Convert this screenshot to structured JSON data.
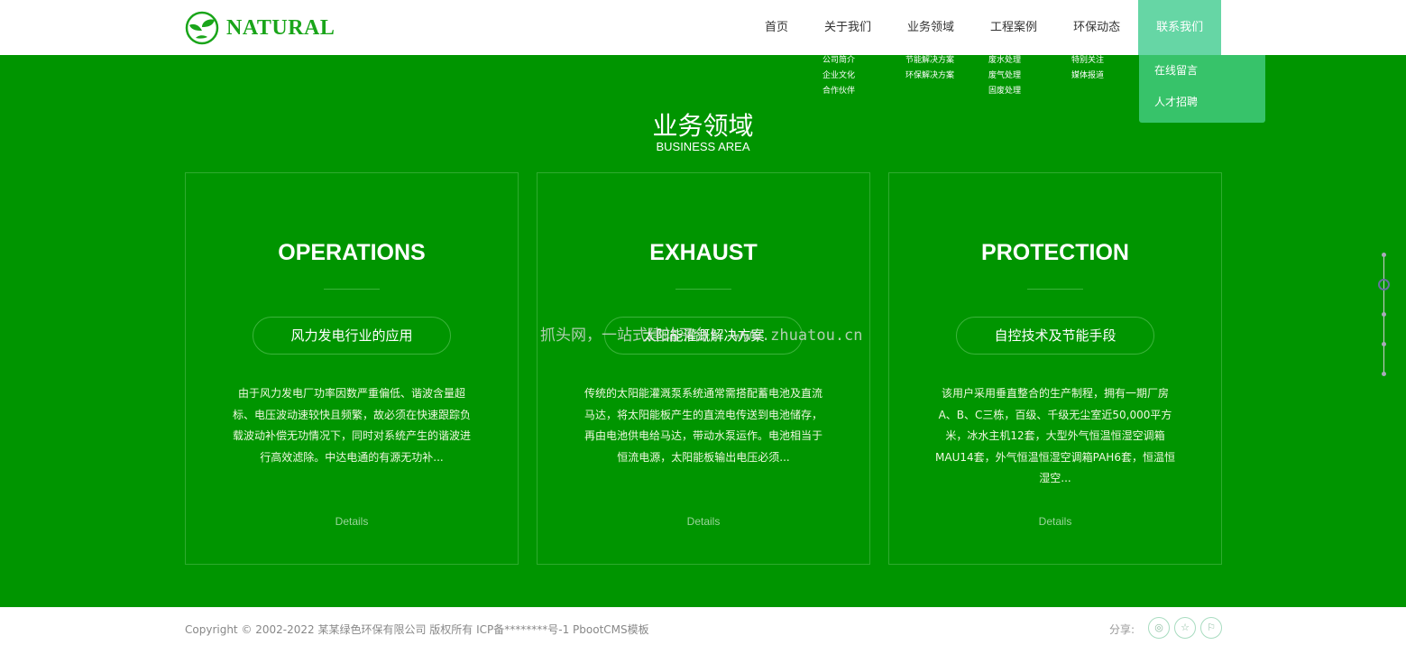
{
  "logo": {
    "text": "NATURAL"
  },
  "nav": {
    "items": [
      "首页",
      "关于我们",
      "业务领域",
      "工程案例",
      "环保动态",
      "联系我们"
    ]
  },
  "submenus": {
    "about": [
      "公司简介",
      "企业文化",
      "合作伙伴"
    ],
    "business": [
      "节能解决方案",
      "环保解决方案"
    ],
    "cases": [
      "废水处理",
      "废气处理",
      "固废处理"
    ],
    "news": [
      "特别关注",
      "媒体报道"
    ],
    "contact": [
      "在线留言",
      "人才招聘"
    ]
  },
  "section": {
    "title": "业务领域",
    "subtitle": "BUSINESS AREA"
  },
  "cards": [
    {
      "title": "OPERATIONS",
      "pill": "风力发电行业的应用",
      "text": "由于风力发电厂功率因数严重偏低、谐波含量超标、电压波动速较快且频繁，故必须在快速跟踪负载波动补偿无功情况下，同时对系统产生的谐波进行高效滤除。中达电通的有源无功补...",
      "details": "Details"
    },
    {
      "title": "EXHAUST",
      "pill": "太阳能灌溉解决方案",
      "text": "传统的太阳能灌溉泵系统通常需搭配蓄电池及直流马达，将太阳能板产生的直流电传送到电池储存，再由电池供电给马达，带动水泵运作。电池相当于恒流电源，太阳能板输出电压必须...",
      "details": "Details"
    },
    {
      "title": "PROTECTION",
      "pill": "自控技术及节能手段",
      "text": "该用户采用垂直整合的生产制程，拥有一期厂房A、B、C三栋，百级、千级无尘室近50,000平方米，冰水主机12套，大型外气恒温恒湿空调箱MAU14套，外气恒温恒湿空调箱PAH6套，恒温恒湿空...",
      "details": "Details"
    }
  ],
  "watermark": "抓头网，一站式建站平台！ www.zhuatou.cn",
  "footer": {
    "copyright": "Copyright © 2002-2022 某某绿色环保有限公司 版权所有  ICP备********号-1 PbootCMS模板",
    "share_label": "分享:"
  },
  "colors": {
    "primary": "#009500",
    "nav_active": "#66d6a5",
    "dropdown": "#37c36a"
  }
}
